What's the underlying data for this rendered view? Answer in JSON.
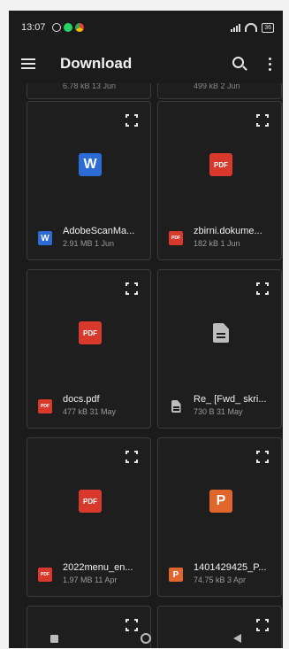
{
  "status_bar": {
    "time": "13:07",
    "battery": "36",
    "icons": [
      "alarm-icon",
      "whatsapp-icon",
      "chrome-icon",
      "signal-icon",
      "wifi-icon",
      "battery-icon"
    ]
  },
  "appbar": {
    "title": "Download",
    "icons": [
      "menu-icon",
      "search-icon",
      "more-options-icon"
    ]
  },
  "partial_top": [
    {
      "meta": "6.78 kB 13 Jun"
    },
    {
      "meta": "499 kB 2 Jun"
    }
  ],
  "files": [
    {
      "name": "AdobeScanMa...",
      "meta": "2.91 MB 1 Jun",
      "type": "word",
      "icon_label": "W"
    },
    {
      "name": "zbirni.dokume...",
      "meta": "182 kB 1 Jun",
      "type": "pdf",
      "icon_label": "PDF"
    },
    {
      "name": "docs.pdf",
      "meta": "477 kB 31 May",
      "type": "pdf",
      "icon_label": "PDF"
    },
    {
      "name": "Re_ [Fwd_ skri...",
      "meta": "730 B 31 May",
      "type": "doc",
      "icon_label": ""
    },
    {
      "name": "2022menu_en...",
      "meta": "1.97 MB 11 Apr",
      "type": "pdf",
      "icon_label": "PDF"
    },
    {
      "name": "1401429425_P...",
      "meta": "74.75 kB 3 Apr",
      "type": "ppt",
      "icon_label": "P"
    }
  ],
  "colors": {
    "background": "#1b1b1b",
    "card_border": "#3a3a3a",
    "word": "#2d6bd6",
    "pdf": "#d8392c",
    "ppt": "#e0662c"
  }
}
